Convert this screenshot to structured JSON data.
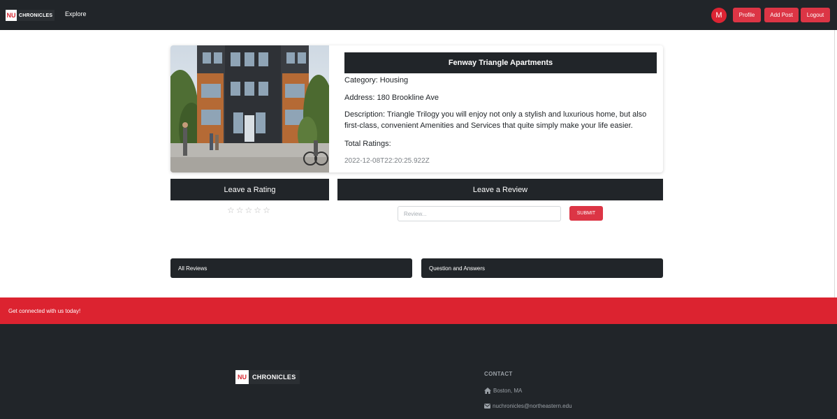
{
  "navbar": {
    "brand_nu": "NU",
    "brand_name": "CHRONICLES",
    "explore_label": "Explore",
    "avatar_initial": "M",
    "profile_label": "Profile",
    "add_post_label": "Add Post",
    "logout_label": "Logout"
  },
  "post": {
    "title": "Fenway Triangle Apartments",
    "category": "Category: Housing",
    "address": "Address: 180 Brookline Ave",
    "description": "Description: Triangle Trilogy you will enjoy not only a stylish and luxurious home, but also first-class, convenient Amenities and Services that quite simply make your life easier.",
    "total_ratings": "Total Ratings:",
    "timestamp": "2022-12-08T22:20:25.922Z",
    "image_icon": "building-photo"
  },
  "rating": {
    "header": "Leave a Rating",
    "stars": [
      "☆",
      "☆",
      "☆",
      "☆",
      "☆"
    ]
  },
  "review": {
    "header": "Leave a Review",
    "placeholder": "Review...",
    "submit_label": "SUBMIT"
  },
  "tabs": {
    "all_reviews": "All Reviews",
    "qa": "Question and Answers"
  },
  "footer": {
    "connect_text": "Get connected with us today!",
    "brand_nu": "NU",
    "brand_name": "CHRONICLES",
    "contact_title": "CONTACT",
    "location": "Boston, MA",
    "email": "nuchronicles@northeastern.edu"
  },
  "colors": {
    "accent": "#dc3545",
    "dark": "#212529"
  }
}
